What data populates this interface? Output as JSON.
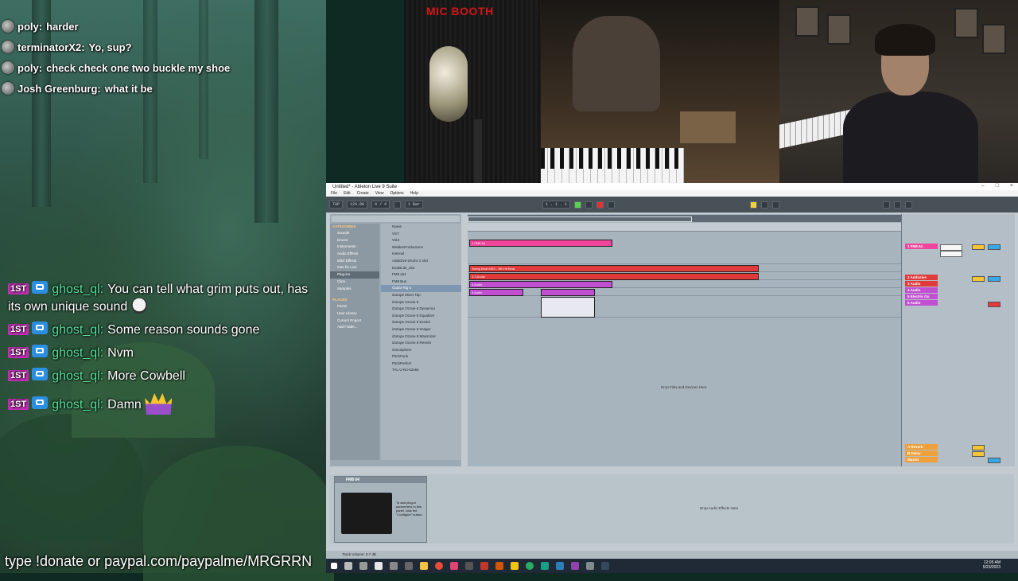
{
  "overlay": {
    "top_chat": [
      {
        "user": "poly:",
        "text": "harder"
      },
      {
        "user": "terminatorX2:",
        "text": "Yo, sup?"
      },
      {
        "user": "poly:",
        "text": "check check one two buckle my shoe"
      },
      {
        "user": "Josh Greenburg:",
        "text": "what it be"
      }
    ],
    "main_chat": [
      {
        "badge": "1ST",
        "user": "ghost_ql:",
        "text": "You can tell what grim puts out, has its own unique sound",
        "emote": "skull-emote"
      },
      {
        "badge": "1ST",
        "user": "ghost_ql:",
        "text": "Some reason sounds gone"
      },
      {
        "badge": "1ST",
        "user": "ghost_ql:",
        "text": "Nvm"
      },
      {
        "badge": "1ST",
        "user": "ghost_ql:",
        "text": "More Cowbell"
      },
      {
        "badge": "1ST",
        "user": "ghost_ql:",
        "text": "Damn",
        "emote": "crown-emote"
      }
    ],
    "donate_text": "type !donate or paypal.com/paypalme/MRGRRN",
    "booth_label": "MIC BOOTH"
  },
  "ableton": {
    "title": "Untitled* - Ableton Live 9 Suite",
    "menu": [
      "File",
      "Edit",
      "Create",
      "View",
      "Options",
      "Help"
    ],
    "transport": {
      "tempo": "124.00",
      "signature": "4 / 4",
      "position": "1 . 1 . 1",
      "quantize": "1 Bar"
    },
    "browser": {
      "search_placeholder": "Search (Ctrl + F)",
      "categories_header": "CATEGORIES",
      "categories": [
        "Sounds",
        "Drums",
        "Instruments",
        "Audio Effects",
        "MIDI Effects",
        "Max for Live",
        "Plug-ins",
        "Clips",
        "Samples"
      ],
      "selected_category": 6,
      "places_header": "PLACES",
      "places": [
        "Packs",
        "User Library",
        "Current Project",
        "Add Folder..."
      ],
      "items": [
        "Name",
        "VST",
        "Vst3",
        "WaldenProductions",
        "Internal",
        "Addictive Drums 2 x64",
        "ExaktLite_x64",
        "FM8 x64",
        "FM8 Bus",
        "Guitar Rig 5",
        "iZotope Mixer Tap",
        "iZotope Ozone 8",
        "iZotope Ozone 8 Dynamics",
        "iZotope Ozone 8 Equalizer",
        "iZotope Ozone 8 Exciter",
        "iZotope Ozone 8 Imager",
        "iZotope Ozone 8 Maximizer",
        "iZotope Ozone 8 Reverb",
        "Omnisphere",
        "PitchFunk",
        "PitchPerfect",
        "TAL-U-No-62x64"
      ],
      "selected_item": 9
    },
    "tracks": [
      {
        "name": "1 FM8 64",
        "color": "#f0459a",
        "clip": "1 FM8 64"
      },
      {
        "name": "2 Addictive",
        "color": "#e03a3a",
        "clip": "Swing Beat MIDI - 8th Hit Beat"
      },
      {
        "name": "3 Audio",
        "color": "#e03a3a",
        "clip": "2-3 Audio"
      },
      {
        "name": "4 Audio",
        "color": "#c150d0",
        "clip": "4 Audio"
      },
      {
        "name": "5 Electric Gu",
        "color": "#c150d0",
        "clip": "5 Audio"
      },
      {
        "name": "6 Audio",
        "color": "#c150d0",
        "clip": "2-Audio 6"
      }
    ],
    "returns": [
      {
        "name": "A Reverb",
        "color": "#f0a03a"
      },
      {
        "name": "B Delay",
        "color": "#f0a03a"
      },
      {
        "name": "Master",
        "color": "#f0a03a"
      }
    ],
    "arrangement_drop": "Drop Files and Devices Here",
    "detail_drop": "Drop Audio Effects Here",
    "device": {
      "name": "FM8 64",
      "preset": "Configure",
      "hint": "To add plug-in parameters to this panel, click the \"Configure\" button."
    },
    "status": "Track Volume: 0.7 dB",
    "ruler_marks": [
      "1",
      "2",
      "3",
      "4",
      "5",
      "6",
      "7",
      "8",
      "9",
      "10",
      "11",
      "12",
      "13",
      "14",
      "15",
      "16",
      "17",
      "18",
      "19",
      "20",
      "21",
      "22",
      "23",
      "24"
    ]
  },
  "taskbar": {
    "time": "12:05 AM",
    "date": "5/23/2023"
  }
}
